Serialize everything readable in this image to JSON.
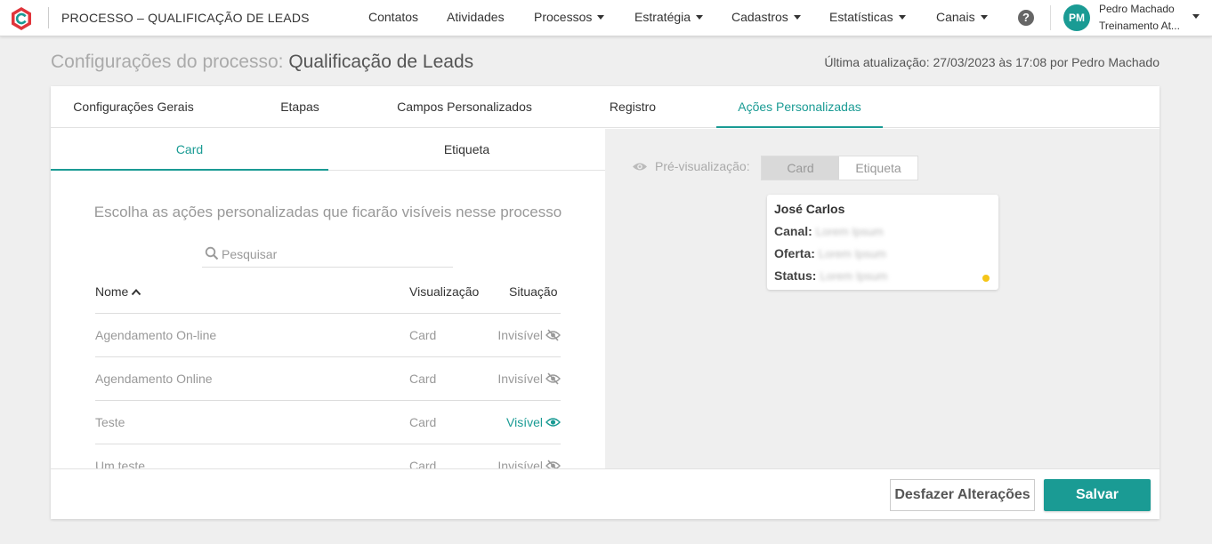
{
  "app": {
    "title": "PROCESSO – QUALIFICAÇÃO DE LEADS"
  },
  "nav": {
    "items": [
      {
        "label": "Contatos",
        "dropdown": false
      },
      {
        "label": "Atividades",
        "dropdown": false
      },
      {
        "label": "Processos",
        "dropdown": true
      },
      {
        "label": "Estratégia",
        "dropdown": true
      },
      {
        "label": "Cadastros",
        "dropdown": true
      },
      {
        "label": "Estatísticas",
        "dropdown": true
      },
      {
        "label": "Canais",
        "dropdown": true
      }
    ],
    "help": "?"
  },
  "user": {
    "initials": "PM",
    "name": "Pedro Machado",
    "org": "Treinamento At..."
  },
  "page": {
    "title_label": "Configurações do processo:",
    "title_value": "Qualificação de Leads",
    "last_update": "Última atualização: 27/03/2023 às 17:08 por Pedro Machado"
  },
  "main_tabs": [
    {
      "label": "Configurações Gerais",
      "active": false
    },
    {
      "label": "Etapas",
      "active": false
    },
    {
      "label": "Campos Personalizados",
      "active": false
    },
    {
      "label": "Registro",
      "active": false
    },
    {
      "label": "Ações Personalizadas",
      "active": true
    }
  ],
  "sub_tabs": [
    {
      "label": "Card",
      "active": true
    },
    {
      "label": "Etiqueta",
      "active": false
    }
  ],
  "left": {
    "instruction": "Escolha as ações personalizadas que ficarão visíveis nesse processo",
    "search_placeholder": "Pesquisar",
    "columns": {
      "name": "Nome",
      "view": "Visualização",
      "state": "Situação"
    },
    "rows": [
      {
        "name": "Agendamento On-line",
        "view": "Card",
        "state": "Invisível",
        "visible": false
      },
      {
        "name": "Agendamento Online",
        "view": "Card",
        "state": "Invisível",
        "visible": false
      },
      {
        "name": "Teste",
        "view": "Card",
        "state": "Visível",
        "visible": true
      },
      {
        "name": "Um teste",
        "view": "Card",
        "state": "Invisível",
        "visible": false
      }
    ]
  },
  "preview": {
    "label": "Pré-visualização:",
    "toggle": {
      "card": "Card",
      "tag": "Etiqueta"
    },
    "card": {
      "name": "José Carlos",
      "fields": [
        {
          "label": "Canal:",
          "value": "Lorem Ipsum"
        },
        {
          "label": "Oferta:",
          "value": "Lorem Ipsum"
        },
        {
          "label": "Status:",
          "value": "Lorem Ipsum"
        }
      ],
      "dot_color": "#f5c518"
    }
  },
  "footer": {
    "undo_label": "Desfazer Alterações",
    "save_label": "Salvar"
  },
  "colors": {
    "accent": "#1a9b94",
    "logo": "#e0353b"
  }
}
